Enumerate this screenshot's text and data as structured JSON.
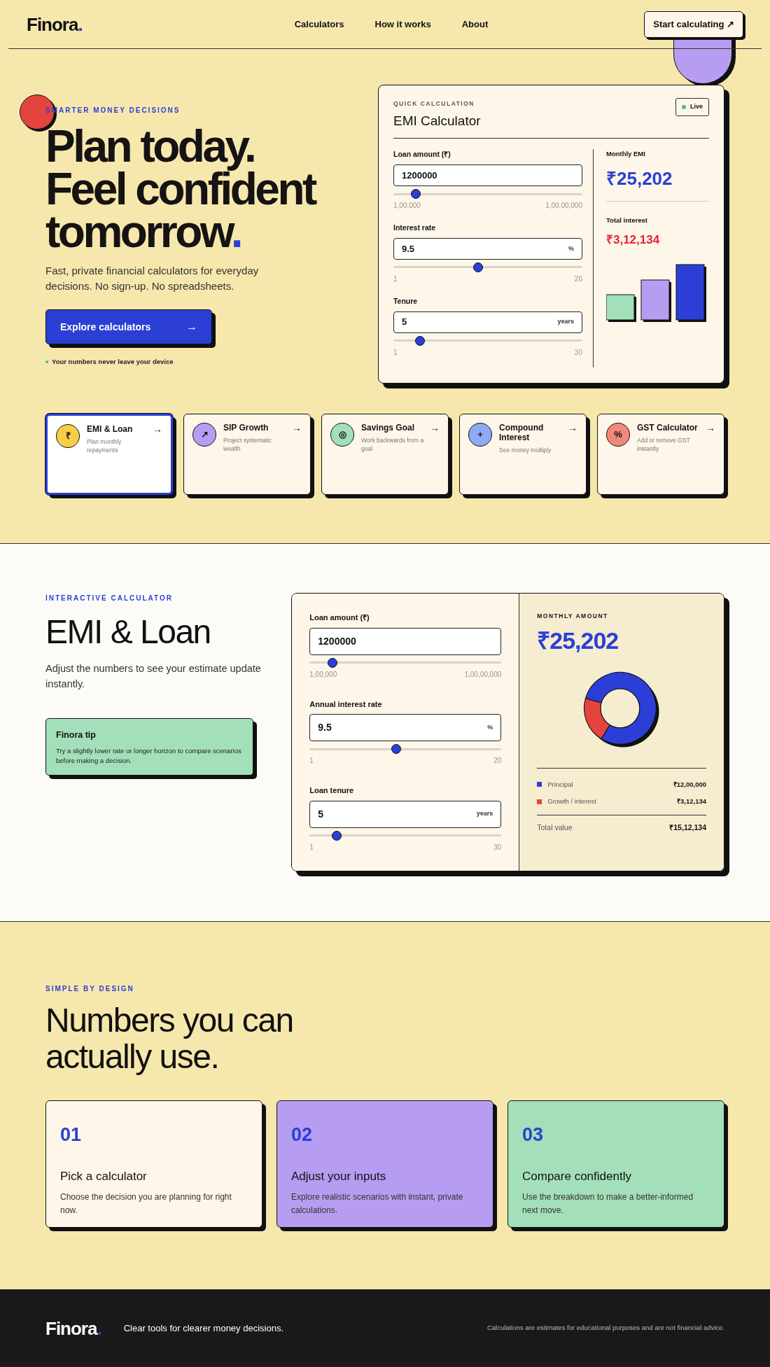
{
  "header": {
    "logo": {
      "name": "Finora",
      "accent": "."
    },
    "nav": [
      "Calculators",
      "How it works",
      "About"
    ],
    "cta": "Start calculating ↗"
  },
  "hero": {
    "eyebrow": "SMARTER MONEY DECISIONS",
    "headline": {
      "lines": [
        "Plan today.",
        "Feel confident",
        "tomorrow"
      ],
      "accent": "."
    },
    "subtitle": "Fast, private financial calculators for everyday decisions. No sign-up. No spreadsheets.",
    "button": {
      "label": "Explore calculators",
      "arrow": "→"
    },
    "note": "Your numbers never leave your device"
  },
  "quick_calc": {
    "eyebrow": "QUICK CALCULATION",
    "title": "EMI Calculator",
    "badge": "Live",
    "inputs": [
      {
        "label": "Loan amount (₹)",
        "value": "1200000",
        "level": 0.12,
        "min": "1,00,000",
        "max": "1,00,00,000"
      },
      {
        "label": "Interest rate",
        "value": "9.5",
        "unit": "%",
        "level": 0.45,
        "min": "1",
        "max": "20"
      },
      {
        "label": "Tenure",
        "value": "5",
        "unit": "years",
        "level": 0.14,
        "min": "1",
        "max": "30"
      }
    ],
    "results": [
      {
        "label": "Monthly EMI",
        "value": "₹25,202",
        "kind": "primary"
      },
      {
        "label": "Total interest",
        "value": "₹3,12,134",
        "kind": "warning"
      }
    ]
  },
  "calculators": [
    {
      "icon": "₹",
      "color": "#f7cf47",
      "name": "EMI & Loan",
      "description": "Plan monthly repayments",
      "arrow": "→",
      "selected": true
    },
    {
      "icon": "↗",
      "color": "#b79df2",
      "name": "SIP Growth",
      "description": "Project systematic wealth",
      "arrow": "→",
      "selected": false
    },
    {
      "icon": "◎",
      "color": "#a3dfb8",
      "name": "Savings Goal",
      "description": "Work backwards from a goal",
      "arrow": "→",
      "selected": false
    },
    {
      "icon": "+",
      "color": "#8ea9f5",
      "name": "Compound Interest",
      "description": "See money multiply",
      "arrow": "→",
      "selected": false
    },
    {
      "icon": "%",
      "color": "#f2887c",
      "name": "GST Calculator",
      "description": "Add or remove GST instantly",
      "arrow": "→",
      "selected": false
    }
  ],
  "emi_section": {
    "eyebrow": "INTERACTIVE CALCULATOR",
    "title": "EMI & Loan",
    "subtitle": "Adjust the numbers to see your estimate update instantly.",
    "tip": {
      "title": "Finora tip",
      "text": "Try a slightly lower rate or longer horizon to compare scenarios before making a decision."
    },
    "inputs": [
      {
        "label": "Loan amount (₹)",
        "value": "1200000",
        "level": 0.12,
        "min": "1,00,000",
        "max": "1,00,00,000"
      },
      {
        "label": "Annual interest rate",
        "value": "9.5",
        "unit": "%",
        "level": 0.45,
        "min": "1",
        "max": "20"
      },
      {
        "label": "Loan tenure",
        "value": "5",
        "unit": "years",
        "level": 0.14,
        "min": "1",
        "max": "30"
      }
    ],
    "result": {
      "eyebrow": "MONTHLY AMOUNT",
      "value": "₹25,202",
      "chart_data": {
        "type": "donut",
        "values": [
          79.4,
          20.6
        ]
      },
      "legend": [
        {
          "label": "Principal",
          "value": "₹12,00,000",
          "color": "#2b3fd6"
        },
        {
          "label": "Growth / interest",
          "value": "₹3,12,134",
          "color": "#e5443e"
        }
      ],
      "total": {
        "label": "Total value",
        "value": "₹15,12,134"
      }
    }
  },
  "steps_section": {
    "eyebrow": "SIMPLE BY DESIGN",
    "title": "Numbers you can actually use.",
    "steps": [
      {
        "number": "01",
        "title": "Pick a calculator",
        "text": "Choose the decision you are planning for right now.",
        "color": "#fdf6e9"
      },
      {
        "number": "02",
        "title": "Adjust your inputs",
        "text": "Explore realistic scenarios with instant, private calculations.",
        "color": "#b79df2"
      },
      {
        "number": "03",
        "title": "Compare confidently",
        "text": "Use the breakdown to make a better-informed next move.",
        "color": "#a3dfb8"
      }
    ]
  },
  "footer": {
    "logo": {
      "name": "Finora",
      "accent": "."
    },
    "tagline": "Clear tools for clearer money decisions.",
    "disclaimer": "Calculations are estimates for educational purposes and are not financial advice."
  }
}
